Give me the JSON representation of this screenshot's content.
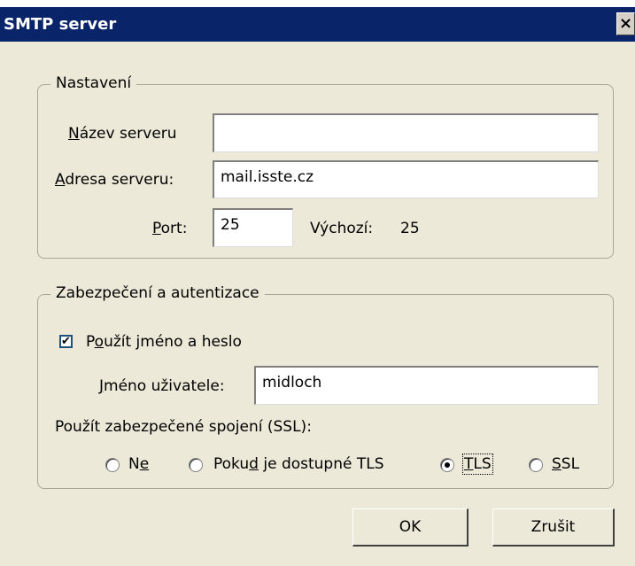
{
  "window": {
    "title": "SMTP server",
    "close_glyph": "×"
  },
  "settings": {
    "legend": "Nastavení",
    "server_name": {
      "label_accel": "N",
      "label_rest": "ázev serveru",
      "value": ""
    },
    "server_address": {
      "label_accel": "A",
      "label_rest": "dresa serveru:",
      "value": "mail.isste.cz"
    },
    "port": {
      "label_accel": "P",
      "label_rest": "ort:",
      "value": "25"
    },
    "default_port": {
      "label": "Výchozí:",
      "value": "25"
    }
  },
  "security": {
    "legend": "Zabezpečení a autentizace",
    "use_credentials": {
      "label_pre": "P",
      "label_accel": "o",
      "label_rest": "užít jméno a heslo",
      "checked": true,
      "check_glyph": "✔"
    },
    "username": {
      "label_accel": "J",
      "label_rest": "méno uživatele:",
      "value": "midloch"
    },
    "ssl_label": "Použít zabezpečené spojení (SSL):",
    "options": {
      "ne": {
        "pre": "N",
        "accel": "e",
        "post": "",
        "selected": false
      },
      "tls_if_available": {
        "pre": "Poku",
        "accel": "d",
        "post": " je dostupné TLS",
        "selected": false
      },
      "tls": {
        "pre": "",
        "accel": "T",
        "post": "LS",
        "selected": true
      },
      "ssl": {
        "pre": "",
        "accel": "S",
        "post": "SL",
        "selected": false
      }
    }
  },
  "buttons": {
    "ok": "OK",
    "cancel": "Zrušit"
  }
}
